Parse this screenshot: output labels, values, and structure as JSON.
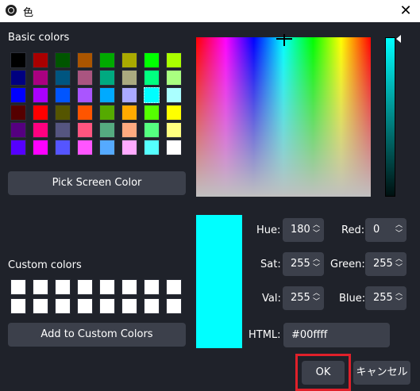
{
  "window": {
    "title": "色",
    "close_glyph": "✕"
  },
  "basic_colors": {
    "label": "Basic colors",
    "rows": [
      [
        "#000000",
        "#aa0000",
        "#005500",
        "#aa5500",
        "#00aa00",
        "#aaaa00",
        "#00ff00",
        "#aaff00"
      ],
      [
        "#000080",
        "#aa0080",
        "#005580",
        "#aa5580",
        "#00aa80",
        "#aaaa80",
        "#00ff80",
        "#aaff80"
      ],
      [
        "#0000ff",
        "#aa00ff",
        "#0055ff",
        "#aa55ff",
        "#00aaff",
        "#aaaaff",
        "#00ffff",
        "#aaffff"
      ],
      [
        "#550000",
        "#ff0000",
        "#555500",
        "#ff5500",
        "#55aa00",
        "#ffaa00",
        "#55ff00",
        "#ffff00"
      ],
      [
        "#550080",
        "#ff0080",
        "#555580",
        "#ff5580",
        "#55aa80",
        "#ffaa80",
        "#55ff80",
        "#ffff80"
      ],
      [
        "#5500ff",
        "#ff00ff",
        "#5555ff",
        "#ff55ff",
        "#55aaff",
        "#ffaaff",
        "#55ffff",
        "#ffffff"
      ]
    ],
    "selected": "#00ffff"
  },
  "pick_screen_color_label": "Pick Screen Color",
  "custom_colors": {
    "label": "Custom colors",
    "rows": [
      [
        "#ffffff",
        "#ffffff",
        "#ffffff",
        "#ffffff",
        "#ffffff",
        "#ffffff",
        "#ffffff",
        "#ffffff"
      ],
      [
        "#ffffff",
        "#ffffff",
        "#ffffff",
        "#ffffff",
        "#ffffff",
        "#ffffff",
        "#ffffff",
        "#ffffff"
      ]
    ]
  },
  "add_custom_label": "Add to Custom Colors",
  "current_color": "#00ffff",
  "fields": {
    "hue": {
      "label": "Hue:",
      "value": "180"
    },
    "sat": {
      "label": "Sat:",
      "value": "255"
    },
    "val": {
      "label": "Val:",
      "value": "255"
    },
    "red": {
      "label": "Red:",
      "value": "0"
    },
    "green": {
      "label": "Green:",
      "value": "255"
    },
    "blue": {
      "label": "Blue:",
      "value": "255"
    },
    "html": {
      "label": "HTML:",
      "value": "#00ffff"
    }
  },
  "buttons": {
    "ok": "OK",
    "cancel": "キャンセル"
  },
  "icons": {
    "up": "︿",
    "down": "﹀"
  }
}
